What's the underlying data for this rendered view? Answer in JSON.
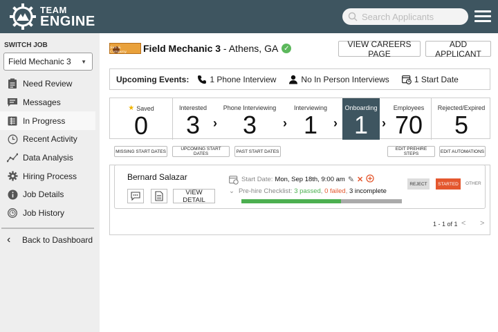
{
  "header": {
    "logo_line1": "TEAM",
    "logo_line2": "ENGINE",
    "search_placeholder": "Search Applicants",
    "accent": "#3e5560"
  },
  "sidebar": {
    "switch_label": "SWITCH JOB",
    "selected_job": "Field Mechanic 3",
    "items": [
      {
        "label": "Need Review",
        "icon": "clipboard-icon"
      },
      {
        "label": "Messages",
        "icon": "message-icon"
      },
      {
        "label": "In Progress",
        "icon": "list-icon"
      },
      {
        "label": "Recent Activity",
        "icon": "clock-icon"
      },
      {
        "label": "Data Analysis",
        "icon": "chart-line-icon"
      },
      {
        "label": "Hiring Process",
        "icon": "gear-icon"
      },
      {
        "label": "Job Details",
        "icon": "info-icon"
      },
      {
        "label": "Job History",
        "icon": "history-icon"
      }
    ],
    "active_index": 2,
    "back_label": "Back to Dashboard"
  },
  "job": {
    "logo_text": "Sun & Company",
    "title": "Field Mechanic 3",
    "location": " - Athens, GA"
  },
  "actions": {
    "careers": "VIEW CAREERS PAGE",
    "add": "ADD APPLICANT"
  },
  "events": {
    "label": "Upcoming Events:",
    "phone": "1 Phone Interview",
    "in_person": "No In Person Interviews",
    "start": "1 Start Date"
  },
  "pipeline": [
    {
      "label": "Saved",
      "value": "0",
      "star": true
    },
    {
      "label": "Interested",
      "value": "3"
    },
    {
      "label": "Phone Interviewing",
      "value": "3"
    },
    {
      "label": "Interviewing",
      "value": "1"
    },
    {
      "label": "Onboarding",
      "value": "1",
      "active": true
    },
    {
      "label": "Employees",
      "value": "70"
    },
    {
      "label": "Rejected/Expired",
      "value": "5"
    }
  ],
  "filters": {
    "missing": "MISSING START DATES",
    "upcoming": "UPCOMING START DATES",
    "past": "PAST START DATES",
    "edit_prehire": "EDIT PREHIRE STEPS",
    "edit_automations": "EDIT AUTOMATIONS"
  },
  "candidate": {
    "name": "Bernard Salazar",
    "view_detail": "VIEW DETAIL",
    "start_label": "Start Date:",
    "start_value": "Mon, Sep 18th, 9:00 am",
    "checklist_label": "Pre-hire Checklist:",
    "passed": "3 passed",
    "failed": "0 failed",
    "incomplete": "3 incomplete",
    "progress_fraction": 0.62,
    "reject": "REJECT",
    "started": "STARTED",
    "other": "OTHER"
  },
  "pager": {
    "text": "1 - 1 of 1",
    "prev": "<",
    "next": ">"
  }
}
